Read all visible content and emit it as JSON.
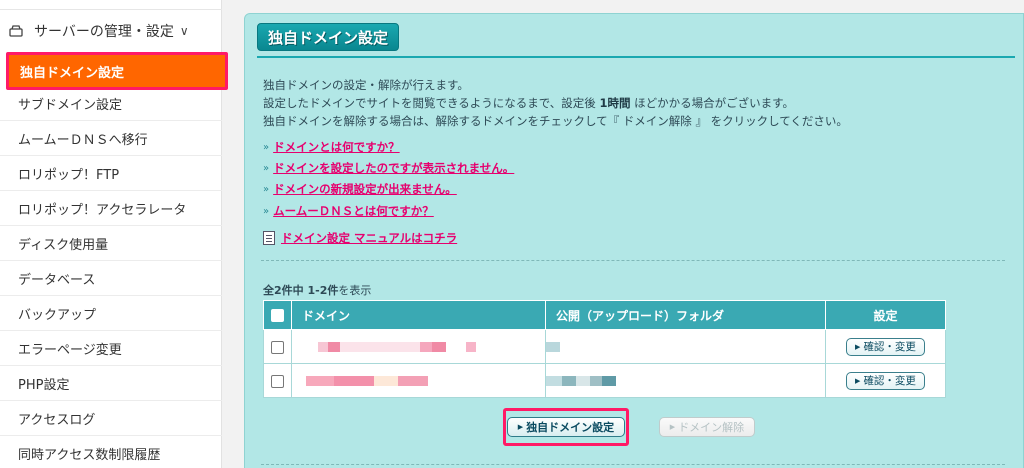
{
  "sidebar": {
    "section_title": "サーバーの管理・設定",
    "items": [
      {
        "label": "独自ドメイン設定",
        "active": true
      },
      {
        "label": "サブドメイン設定"
      },
      {
        "label": "ムームーＤＮＳへ移行"
      },
      {
        "label": "ロリポップ！FTP"
      },
      {
        "label": "ロリポップ！アクセラレータ"
      },
      {
        "label": "ディスク使用量"
      },
      {
        "label": "データベース"
      },
      {
        "label": "バックアップ"
      },
      {
        "label": "エラーページ変更"
      },
      {
        "label": "PHP設定"
      },
      {
        "label": "アクセスログ"
      },
      {
        "label": "同時アクセス数制限履歴"
      }
    ]
  },
  "main": {
    "title": "独自ドメイン設定",
    "desc1": "独自ドメインの設定・解除が行えます。",
    "desc2_a": "設定したドメインでサイトを閲覧できるようになるまで、設定後 ",
    "desc2_b": "1時間",
    "desc2_c": " ほどかかる場合がございます。",
    "desc3": "独自ドメインを解除する場合は、解除するドメインをチェックして『 ドメイン解除 』 をクリックしてください。",
    "help_links": [
      "ドメインとは何ですか？",
      "ドメインを設定したのですが表示されません。",
      "ドメインの新規設定が出来ません。",
      "ムームーＤＮＳとは何ですか？"
    ],
    "manual_link": "ドメイン設定 マニュアルはコチラ",
    "count_a": "全2件中 1-2件",
    "count_b": "を表示",
    "table": {
      "headers": [
        "ドメイン",
        "公開（アップロード）フォルダ",
        "設定"
      ],
      "rows": [
        {
          "button": "確認・変更"
        },
        {
          "button": "確認・変更"
        }
      ]
    },
    "buttons": {
      "add": "独自ドメイン設定",
      "remove": "ドメイン解除"
    }
  },
  "colors": {
    "active_item": "#ff6600",
    "highlight_border": "#ff1a66",
    "panel_bg": "#b2e7e6",
    "table_header": "#3aa9b3",
    "link": "#e6006e"
  }
}
